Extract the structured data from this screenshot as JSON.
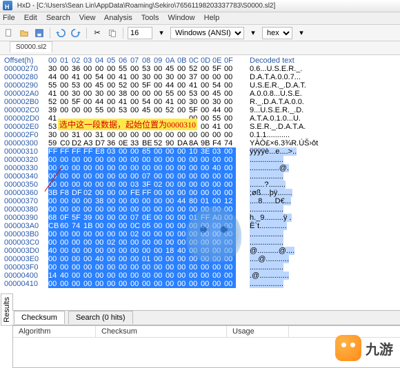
{
  "title": "HxD - [C:\\Users\\Sean Lin\\AppData\\Roaming\\Sekiro\\76561198203337783\\S0000.sl2]",
  "menu": [
    "File",
    "Edit",
    "Search",
    "View",
    "Analysis",
    "Tools",
    "Window",
    "Help"
  ],
  "toolbar": {
    "bytes_per_row": "16",
    "encoding": "Windows (ANSI)",
    "view_mode": "hex"
  },
  "tab_name": "S0000.sl2",
  "annotation": "选中这一段数据，起始位置为0000310",
  "hex": {
    "header_offset": "Offset(h)",
    "header_cols": [
      "00",
      "01",
      "02",
      "03",
      "04",
      "05",
      "06",
      "07",
      "08",
      "09",
      "0A",
      "0B",
      "0C",
      "0D",
      "0E",
      "0F"
    ],
    "header_decoded": "Decoded text",
    "rows": [
      {
        "o": "00000270",
        "b": [
          "30",
          "00",
          "36",
          "00",
          "00",
          "00",
          "55",
          "00",
          "53",
          "00",
          "45",
          "00",
          "52",
          "00",
          "5F",
          "00"
        ],
        "t": "0.6...U.S.E.R._."
      },
      {
        "o": "00000280",
        "b": [
          "44",
          "00",
          "41",
          "00",
          "54",
          "00",
          "41",
          "00",
          "30",
          "00",
          "30",
          "00",
          "37",
          "00",
          "00",
          "00"
        ],
        "t": "D.A.T.A.0.0.7..."
      },
      {
        "o": "00000290",
        "b": [
          "55",
          "00",
          "53",
          "00",
          "45",
          "00",
          "52",
          "00",
          "5F",
          "00",
          "44",
          "00",
          "41",
          "00",
          "54",
          "00"
        ],
        "t": "U.S.E.R._.D.A.T."
      },
      {
        "o": "000002A0",
        "b": [
          "41",
          "00",
          "30",
          "00",
          "30",
          "00",
          "38",
          "00",
          "00",
          "00",
          "55",
          "00",
          "53",
          "00",
          "45",
          "00"
        ],
        "t": "A.0.0.8...U.S.E."
      },
      {
        "o": "000002B0",
        "b": [
          "52",
          "00",
          "5F",
          "00",
          "44",
          "00",
          "41",
          "00",
          "54",
          "00",
          "41",
          "00",
          "30",
          "00",
          "30",
          "00"
        ],
        "t": "R._.D.A.T.A.0.0."
      },
      {
        "o": "000002C0",
        "b": [
          "39",
          "00",
          "00",
          "00",
          "55",
          "00",
          "53",
          "00",
          "45",
          "00",
          "52",
          "00",
          "5F",
          "00",
          "44",
          "00"
        ],
        "t": "9...U.S.E.R._.D."
      },
      {
        "o": "000002D0",
        "b": [
          "41",
          "",
          "",
          "",
          "",
          "",
          "",
          "",
          "",
          "",
          "",
          "",
          "00",
          "00",
          "55",
          "00"
        ],
        "t": "A.T.A.0.1.0...U.",
        "hl": [
          1,
          11
        ]
      },
      {
        "o": "000002E0",
        "b": [
          "53",
          "",
          "",
          "",
          "",
          "",
          "",
          "",
          "",
          "",
          "",
          "",
          "54",
          "00",
          "41",
          "00"
        ],
        "t": "S.E.R._.D.A.T.A.",
        "hl": [
          1,
          11
        ]
      },
      {
        "o": "000002F0",
        "b": [
          "30",
          "00",
          "31",
          "00",
          "31",
          "00",
          "00",
          "00",
          "00",
          "00",
          "00",
          "00",
          "00",
          "00",
          "00",
          "00"
        ],
        "t": "0.1.1..........."
      },
      {
        "o": "00000300",
        "b": [
          "59",
          "C0",
          "D2",
          "A3",
          "D7",
          "36",
          "0E",
          "33",
          "BE",
          "52",
          "90",
          "DA",
          "8A",
          "9B",
          "F4",
          "74"
        ],
        "t": "YÀÒ£×6.3¾R.ÚŠ›ôt"
      },
      {
        "o": "00000310",
        "b": [
          "FF",
          "FF",
          "FF",
          "FF",
          "E8",
          "03",
          "00",
          "00",
          "65",
          "00",
          "00",
          "00",
          "10",
          "3E",
          "03",
          "00"
        ],
        "t": "ÿÿÿÿè...e....>..",
        "sel": true
      },
      {
        "o": "00000320",
        "b": [
          "00",
          "00",
          "00",
          "00",
          "00",
          "00",
          "00",
          "00",
          "00",
          "00",
          "00",
          "00",
          "00",
          "00",
          "00",
          "00"
        ],
        "t": "................",
        "sel": true
      },
      {
        "o": "00000330",
        "b": [
          "00",
          "00",
          "00",
          "00",
          "00",
          "00",
          "00",
          "00",
          "00",
          "00",
          "00",
          "00",
          "00",
          "00",
          "40",
          "00"
        ],
        "t": "..............@.",
        "sel": true
      },
      {
        "o": "00000340",
        "b": [
          "00",
          "00",
          "00",
          "00",
          "00",
          "00",
          "00",
          "00",
          "07",
          "00",
          "00",
          "00",
          "00",
          "00",
          "00",
          "00"
        ],
        "t": "................",
        "sel": true
      },
      {
        "o": "00000350",
        "b": [
          "00",
          "00",
          "00",
          "00",
          "00",
          "00",
          "00",
          "03",
          "3F",
          "02",
          "00",
          "00",
          "00",
          "00",
          "00",
          "00"
        ],
        "t": ".......?........",
        "sel": true
      },
      {
        "o": "00000360",
        "b": [
          "3B",
          "F8",
          "DF",
          "02",
          "00",
          "00",
          "00",
          "FE",
          "FF",
          "00",
          "00",
          "00",
          "00",
          "00",
          "00",
          "00"
        ],
        "t": ";øß....þÿ.......",
        "sel": true
      },
      {
        "o": "00000370",
        "b": [
          "00",
          "00",
          "00",
          "00",
          "38",
          "00",
          "00",
          "00",
          "00",
          "00",
          "00",
          "44",
          "80",
          "01",
          "00",
          "12"
        ],
        "t": "....8......D€...",
        "sel": true
      },
      {
        "o": "00000380",
        "b": [
          "00",
          "00",
          "00",
          "00",
          "00",
          "00",
          "00",
          "00",
          "00",
          "00",
          "00",
          "00",
          "00",
          "00",
          "00",
          "00"
        ],
        "t": "................",
        "sel": true
      },
      {
        "o": "00000390",
        "b": [
          "68",
          "0F",
          "5F",
          "39",
          "00",
          "00",
          "00",
          "07",
          "0E",
          "00",
          "00",
          "00",
          "01",
          "FF",
          "A0",
          "00"
        ],
        "t": "h._9.........ÿ .",
        "sel": true
      },
      {
        "o": "000003A0",
        "b": [
          "CB",
          "60",
          "74",
          "1B",
          "00",
          "00",
          "00",
          "0C",
          "05",
          "00",
          "00",
          "00",
          "00",
          "00",
          "00",
          "00"
        ],
        "t": "Ë`t.............",
        "sel": true
      },
      {
        "o": "000003B0",
        "b": [
          "00",
          "00",
          "00",
          "00",
          "00",
          "00",
          "00",
          "02",
          "00",
          "00",
          "00",
          "00",
          "00",
          "00",
          "00",
          "00"
        ],
        "t": "................",
        "sel": true
      },
      {
        "o": "000003C0",
        "b": [
          "00",
          "00",
          "00",
          "00",
          "00",
          "02",
          "00",
          "00",
          "00",
          "00",
          "00",
          "00",
          "00",
          "00",
          "00",
          "00"
        ],
        "t": "................",
        "sel": true
      },
      {
        "o": "000003D0",
        "b": [
          "40",
          "00",
          "00",
          "00",
          "00",
          "00",
          "00",
          "00",
          "00",
          "00",
          "18",
          "40",
          "00",
          "00",
          "00",
          "00"
        ],
        "t": "@..........@....",
        "sel": true
      },
      {
        "o": "000003E0",
        "b": [
          "00",
          "00",
          "00",
          "00",
          "40",
          "00",
          "00",
          "00",
          "01",
          "00",
          "00",
          "00",
          "00",
          "00",
          "00",
          "00"
        ],
        "t": "....@...........",
        "sel": true
      },
      {
        "o": "000003F0",
        "b": [
          "00",
          "00",
          "00",
          "00",
          "00",
          "00",
          "00",
          "00",
          "00",
          "00",
          "00",
          "00",
          "00",
          "00",
          "00",
          "00"
        ],
        "t": "................",
        "sel": true
      },
      {
        "o": "00000400",
        "b": [
          "14",
          "40",
          "00",
          "00",
          "00",
          "00",
          "00",
          "00",
          "00",
          "00",
          "00",
          "00",
          "00",
          "00",
          "00",
          "00"
        ],
        "t": ".@..............",
        "sel": true
      },
      {
        "o": "00000410",
        "b": [
          "00",
          "00",
          "00",
          "00",
          "00",
          "00",
          "00",
          "00",
          "00",
          "00",
          "00",
          "00",
          "00",
          "00",
          "00",
          "00"
        ],
        "t": "................",
        "sel": true
      }
    ]
  },
  "bottom": {
    "tabs": [
      "Checksum",
      "Search (0 hits)"
    ],
    "cols": [
      "Algorithm",
      "Checksum",
      "Usage"
    ],
    "side": "Results"
  },
  "logo_text": "九游"
}
